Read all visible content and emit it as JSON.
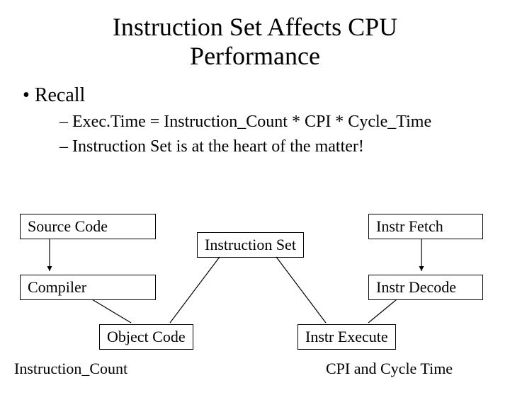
{
  "title_line1": "Instruction Set Affects CPU",
  "title_line2": "Performance",
  "bullets": {
    "recall": "Recall",
    "formula": "Exec.Time = Instruction_Count * CPI * Cycle_Time",
    "heart": "Instruction Set is at the heart of the matter!"
  },
  "diagram": {
    "source_code": "Source Code",
    "compiler": "Compiler",
    "object_code": "Object Code",
    "instruction_set": "Instruction Set",
    "instr_fetch": "Instr Fetch",
    "instr_decode": "Instr Decode",
    "instr_execute": "Instr Execute",
    "ic_label": "Instruction_Count",
    "cpi_label": "CPI and Cycle Time"
  }
}
